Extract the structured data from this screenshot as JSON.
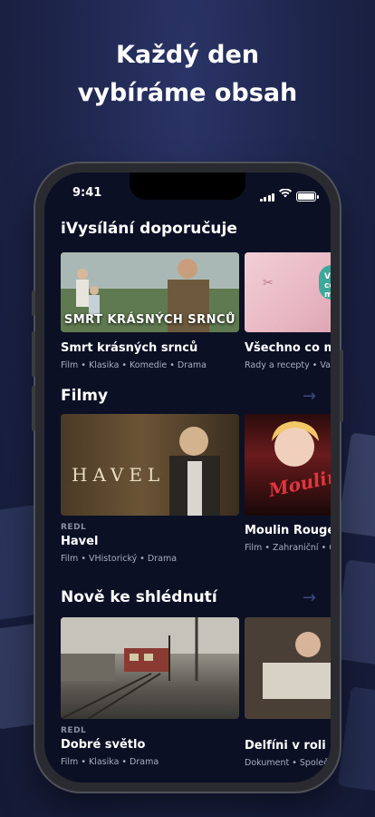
{
  "headline": {
    "line1": "Každý den",
    "line2": "vybíráme obsah"
  },
  "status_bar": {
    "time": "9:41"
  },
  "sections": [
    {
      "title": "iVysílání doporučuje",
      "cards": [
        {
          "title": "Smrt krásných srnců",
          "thumb_caption": "SMRT KRÁSNÝCH SRNCŮ",
          "meta": "Film • Klasika • Komedie • Drama"
        },
        {
          "title": "Všechno co m",
          "thumb_caption": "VŠE co m",
          "meta": "Rady a recepty • Vaře"
        }
      ]
    },
    {
      "title": "Filmy",
      "cards": [
        {
          "tag": "REDL",
          "title": "Havel",
          "thumb_caption": "HAVEL",
          "meta": "Film • VHistorický • Drama"
        },
        {
          "title": "Moulin Rouge",
          "thumb_caption": "Moulin",
          "meta": "Film • Zahraniční • C"
        }
      ]
    },
    {
      "title": "Nově ke shlédnutí",
      "cards": [
        {
          "tag": "REDL",
          "title": "Dobré světlo",
          "meta": "Film • Klasika • Drama"
        },
        {
          "title": "Delfíni v roli",
          "meta": "Dokument • Společ"
        }
      ]
    }
  ],
  "icons": [
    "signal-icon",
    "wifi-icon",
    "battery-icon",
    "arrow-right-icon"
  ],
  "colors": {
    "background": "#1c2347",
    "screen": "#0c1025",
    "arrow": "#3c4a80"
  }
}
